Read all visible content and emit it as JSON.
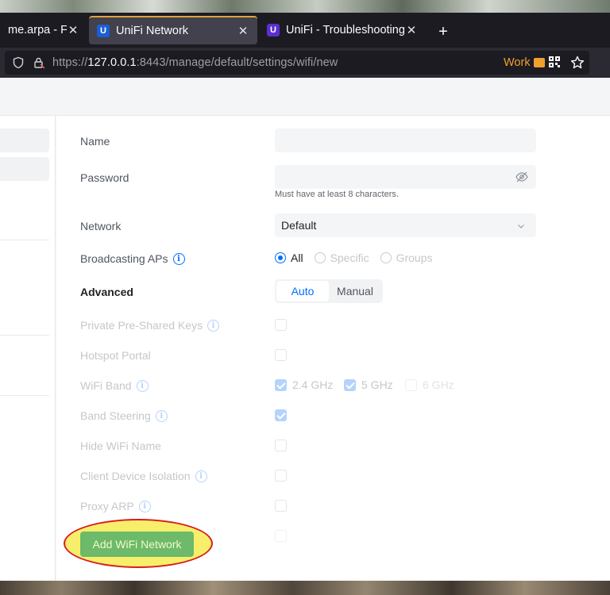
{
  "browser": {
    "tabs": [
      {
        "title": "me.arpa - Fire",
        "favicon": "",
        "active": false
      },
      {
        "title": "UniFi Network",
        "favicon": "U",
        "active": true
      },
      {
        "title": "UniFi - Troubleshooting U",
        "favicon": "U",
        "active": false
      }
    ],
    "url_prefix": "https://",
    "url_host": "127.0.0.1",
    "url_rest": ":8443/manage/default/settings/wifi/new",
    "container_label": "Work",
    "accent_color": "#e0a63c"
  },
  "form": {
    "name": {
      "label": "Name",
      "value": ""
    },
    "password": {
      "label": "Password",
      "value": "",
      "hint": "Must have at least 8 characters."
    },
    "network": {
      "label": "Network",
      "value": "Default"
    },
    "broadcasting": {
      "label": "Broadcasting APs",
      "options": [
        "All",
        "Specific",
        "Groups"
      ],
      "selected": "All"
    },
    "advanced": {
      "label": "Advanced",
      "options": [
        "Auto",
        "Manual"
      ],
      "selected": "Auto"
    },
    "private_psk": {
      "label": "Private Pre-Shared Keys",
      "checked": false
    },
    "hotspot_portal": {
      "label": "Hotspot Portal",
      "checked": false
    },
    "wifi_band": {
      "label": "WiFi Band",
      "bands": [
        {
          "label": "2.4 GHz",
          "checked": true
        },
        {
          "label": "5 GHz",
          "checked": true
        },
        {
          "label": "6 GHz",
          "checked": false
        }
      ]
    },
    "band_steering": {
      "label": "Band Steering",
      "checked": true
    },
    "hide_wifi_name": {
      "label": "Hide WiFi Name",
      "checked": false
    },
    "client_isolation": {
      "label": "Client Device Isolation",
      "checked": false
    },
    "proxy_arp": {
      "label": "Proxy ARP",
      "checked": false
    }
  },
  "actions": {
    "add_label": "Add WiFi Network",
    "add_color": "#6dba6a",
    "highlight_color": "#f7ef6b",
    "highlight_border": "#d91c1c"
  },
  "colors": {
    "primary": "#006fff",
    "disabled_text": "#c4c7cb"
  }
}
